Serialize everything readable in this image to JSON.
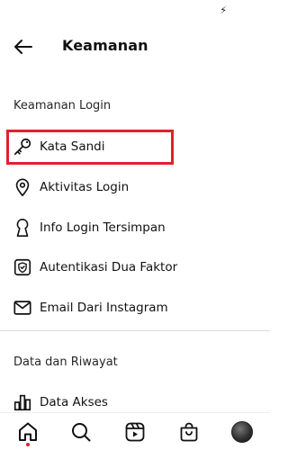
{
  "header": {
    "title": "Keamanan",
    "back_icon": "arrow-left-icon"
  },
  "sections": [
    {
      "title": "Keamanan Login",
      "items": [
        {
          "label": "Kata Sandi",
          "icon": "key-icon",
          "highlighted": true
        },
        {
          "label": "Aktivitas Login",
          "icon": "location-pin-icon"
        },
        {
          "label": "Info Login Tersimpan",
          "icon": "keyhole-icon"
        },
        {
          "label": "Autentikasi Dua Faktor",
          "icon": "shield-check-icon"
        },
        {
          "label": "Email Dari Instagram",
          "icon": "mail-icon"
        }
      ]
    },
    {
      "title": "Data dan Riwayat",
      "items": [
        {
          "label": "Data Akses",
          "icon": "bar-chart-icon"
        }
      ]
    }
  ],
  "bottom_nav": {
    "items": [
      "home-icon",
      "search-icon",
      "reels-icon",
      "shop-icon",
      "profile-avatar"
    ],
    "active": "home-icon"
  },
  "colors": {
    "highlight": "#e0202e",
    "text": "#111111",
    "divider": "#dbdbdb"
  }
}
